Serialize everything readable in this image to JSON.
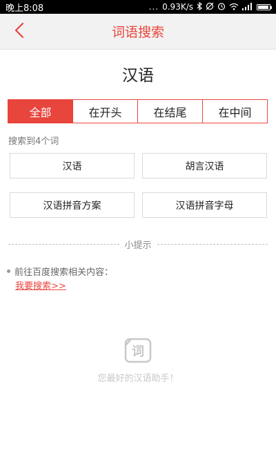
{
  "status_bar": {
    "time": "晚上8:08",
    "net_speed": "0.93K/s",
    "dots": "...",
    "battery_level": 0.92
  },
  "header": {
    "title": "词语搜索",
    "back_icon": "chevron-left-icon"
  },
  "query_word": "汉语",
  "tabs": [
    {
      "label": "全部",
      "active": true
    },
    {
      "label": "在开头",
      "active": false
    },
    {
      "label": "在结尾",
      "active": false
    },
    {
      "label": "在中间",
      "active": false
    }
  ],
  "result_count_text": "搜索到4个词",
  "results": [
    "汉语",
    "胡言汉语",
    "汉语拼音方案",
    "汉语拼音字母"
  ],
  "tips": {
    "label": "小提示",
    "item_text": "前往百度搜索相关内容：",
    "link_text": "我要搜索>>"
  },
  "brand": {
    "logo_char": "词",
    "slogan": "您最好的汉语助手！"
  },
  "colors": {
    "accent": "#e8453c",
    "header_bg": "#f2f2f2"
  }
}
